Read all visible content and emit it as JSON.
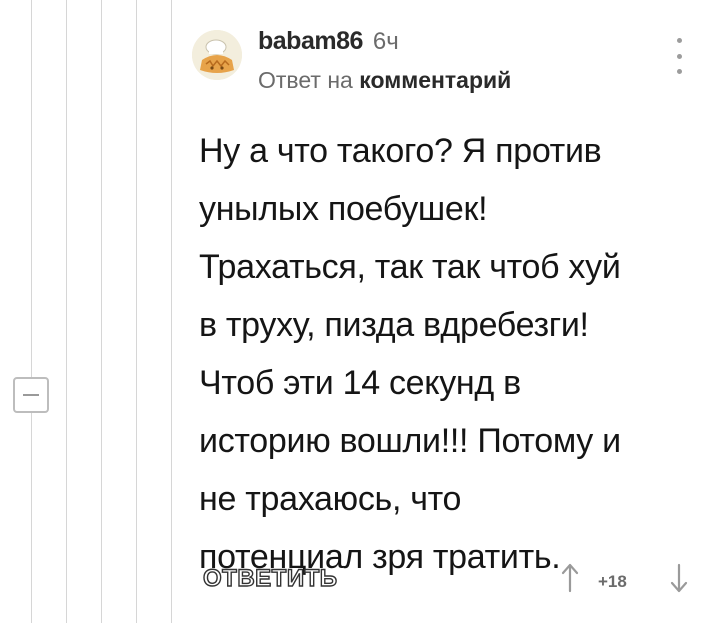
{
  "comment": {
    "username": "babam86",
    "time": "6ч",
    "reply_prefix": "Ответ на",
    "reply_link": "комментарий",
    "text": "Ну а что такого? Я против\nунылых поебушек!\nТрахаться, так так чтоб хуй\nв труху, пизда вдребезги!\nЧтоб эти 14 секунд в\nисторию вошли!!! Потому и\nне трахаюсь, что\nпотенциал зря тратить.",
    "reply_button_label": "ОТВЕТИТЬ",
    "rating": "+18"
  },
  "icons": {
    "avatar": "avatar-image",
    "menu": "vertical-dots-icon",
    "collapse": "collapse-minus-icon",
    "upvote": "arrow-up-icon",
    "downvote": "arrow-down-icon"
  },
  "colors": {
    "text": "#151515",
    "muted": "#6b6b6b",
    "thread_line": "#d6d6d6"
  }
}
